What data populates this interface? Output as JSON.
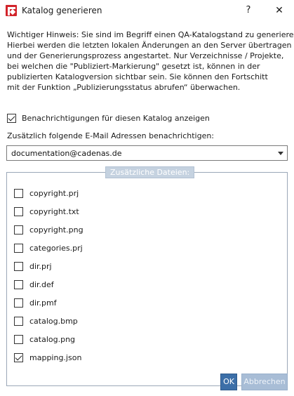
{
  "window": {
    "title": "Katalog generieren",
    "help_label": "?",
    "close_label": "✕"
  },
  "notice": {
    "lines": [
      "Wichtiger Hinweis: Sie sind im Begriff einen QA-Katalogstand zu generieren.",
      "Hierbei werden die letzten lokalen Änderungen an den Server übertragen",
      "und der Generierungsprozess angestartet. Nur Verzeichnisse / Projekte,",
      "bei welchen die \"Publiziert-Markierung\" gesetzt ist, können in der",
      "publizierten Katalogversion sichtbar sein. Sie können den Fortschitt",
      "mit der Funktion „Publizierungsstatus abrufen“ überwachen."
    ]
  },
  "notify": {
    "label": "Benachrichtigungen für diesen Katalog anzeigen",
    "checked": true
  },
  "email": {
    "label": "Zusätzlich folgende E-Mail Adressen benachrichtigen:",
    "value": "documentation@cadenas.de"
  },
  "files": {
    "group_label": "Zusätzliche Dateien:",
    "items": [
      {
        "label": "copyright.prj",
        "checked": false
      },
      {
        "label": "copyright.txt",
        "checked": false
      },
      {
        "label": "copyright.png",
        "checked": false
      },
      {
        "label": "categories.prj",
        "checked": false
      },
      {
        "label": "dir.prj",
        "checked": false
      },
      {
        "label": "dir.def",
        "checked": false
      },
      {
        "label": "dir.pmf",
        "checked": false
      },
      {
        "label": "catalog.bmp",
        "checked": false
      },
      {
        "label": "catalog.png",
        "checked": false
      },
      {
        "label": "mapping.json",
        "checked": true
      }
    ]
  },
  "buttons": {
    "ok": "OK",
    "cancel": "Abbrechen"
  },
  "colors": {
    "ok_button": "#3c6fa8",
    "cancel_button": "#a8bdd6",
    "group_label_bg": "#c5d2e0",
    "app_icon": "#d2232a"
  },
  "icons": {
    "app": "cadenas-logo-icon",
    "dropdown": "chevron-down-icon",
    "close": "close-icon",
    "help": "help-icon"
  }
}
